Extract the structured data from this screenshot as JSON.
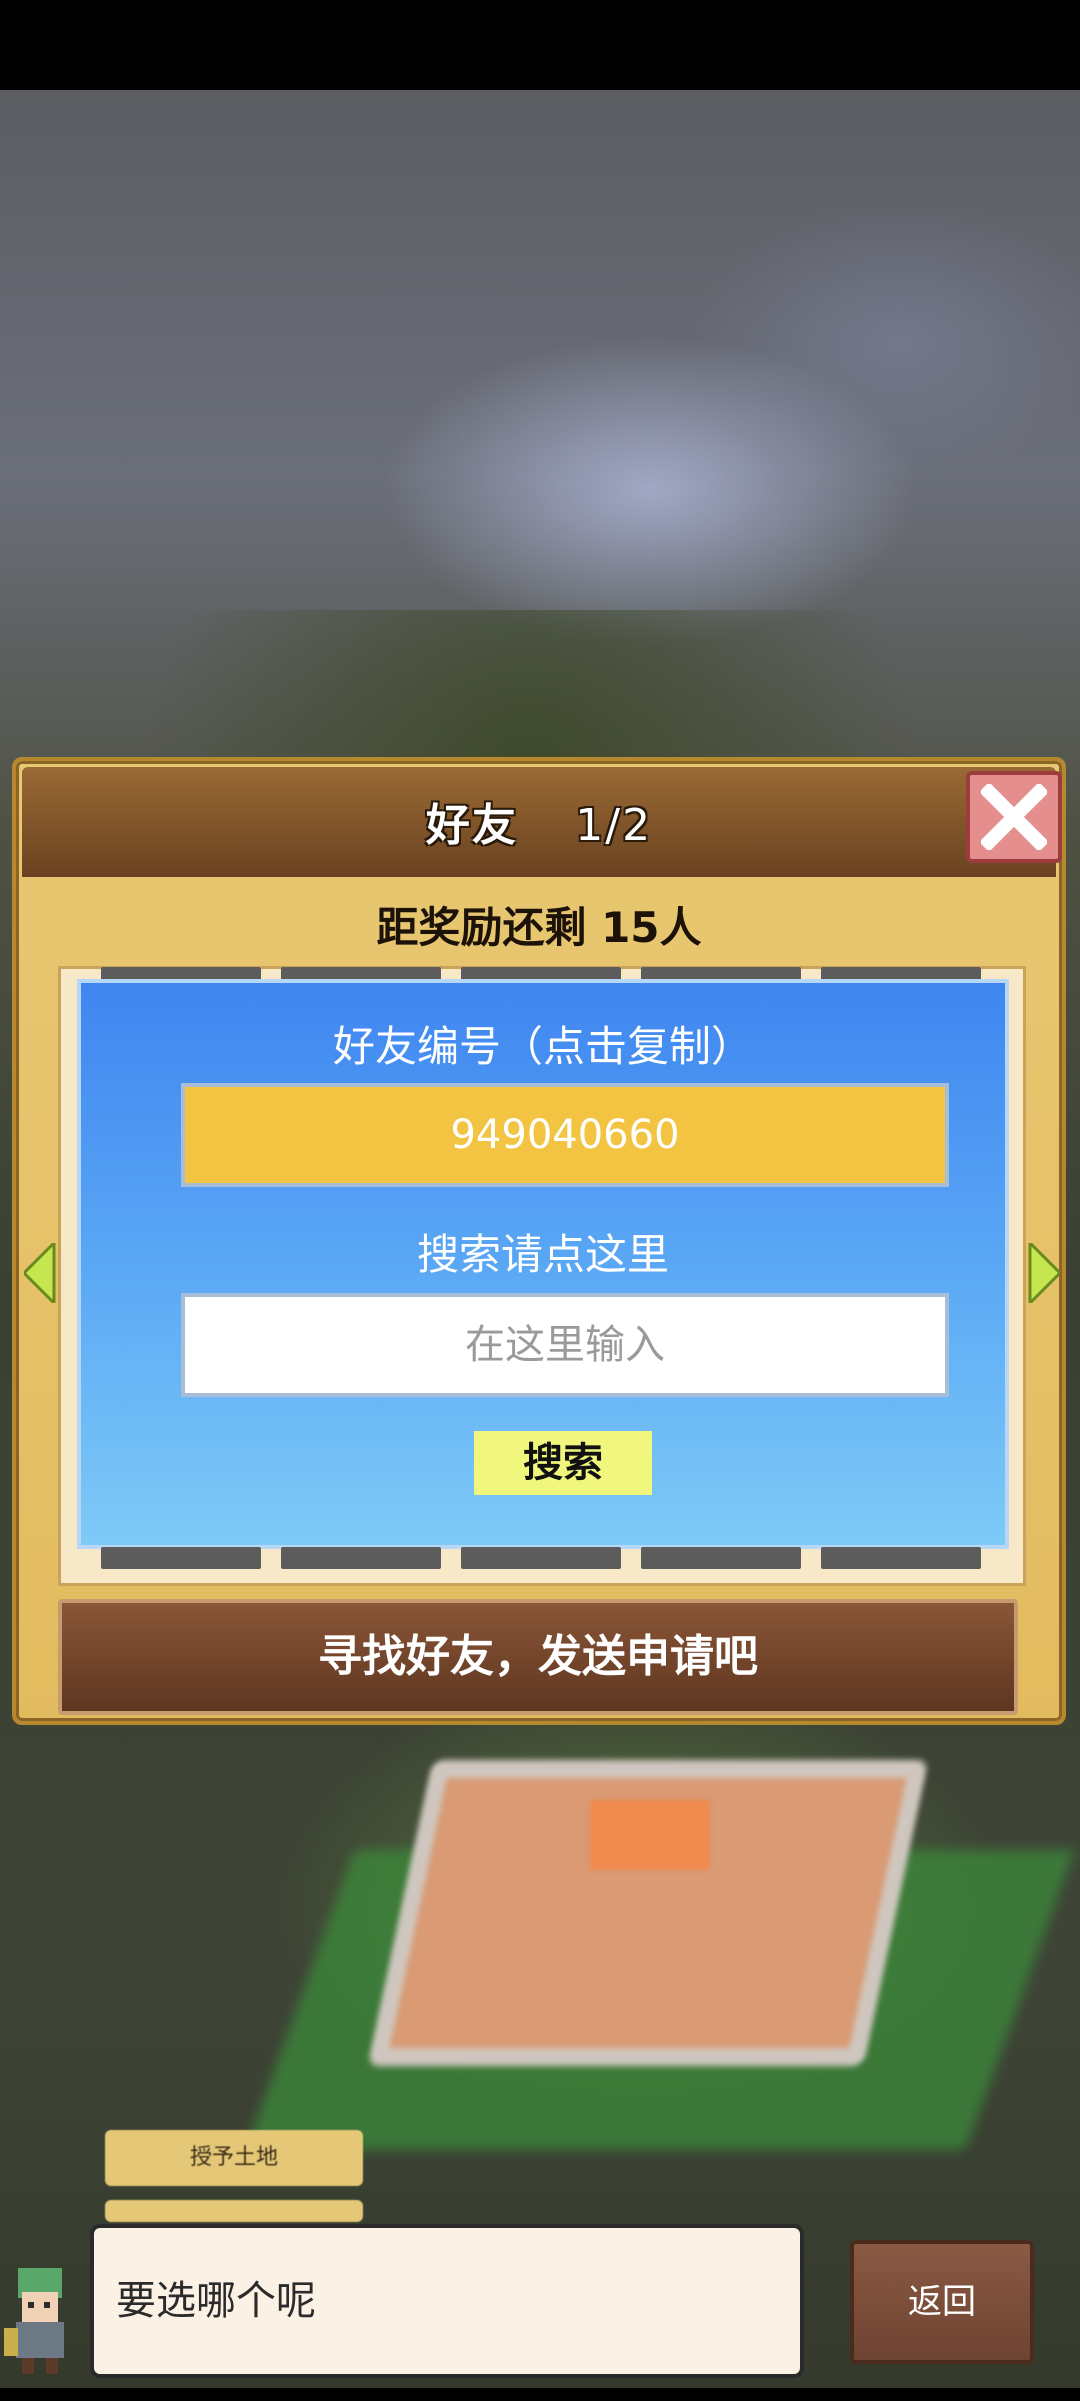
{
  "dialog": {
    "title": "好友",
    "page_indicator": "1/2",
    "reward_remaining": "距奖励还剩 15人",
    "friend_id_label": "好友编号（点击复制）",
    "friend_id_value": "949040660",
    "search_hint": "搜索请点这里",
    "search_placeholder": "在这里输入",
    "search_button": "搜索",
    "cta": "寻找好友，发送申请吧"
  },
  "background": {
    "tab_label": "授予土地"
  },
  "bottom": {
    "speech": "要选哪个呢",
    "back_button": "返回"
  },
  "colors": {
    "panel_blue": "#3f86f0",
    "id_box_yellow": "#f3c441",
    "search_button": "#f1f67d",
    "close_button": "#e58e8e"
  },
  "icons": [
    "close-icon",
    "left-arrow-icon",
    "right-arrow-icon",
    "character-avatar-icon"
  ]
}
